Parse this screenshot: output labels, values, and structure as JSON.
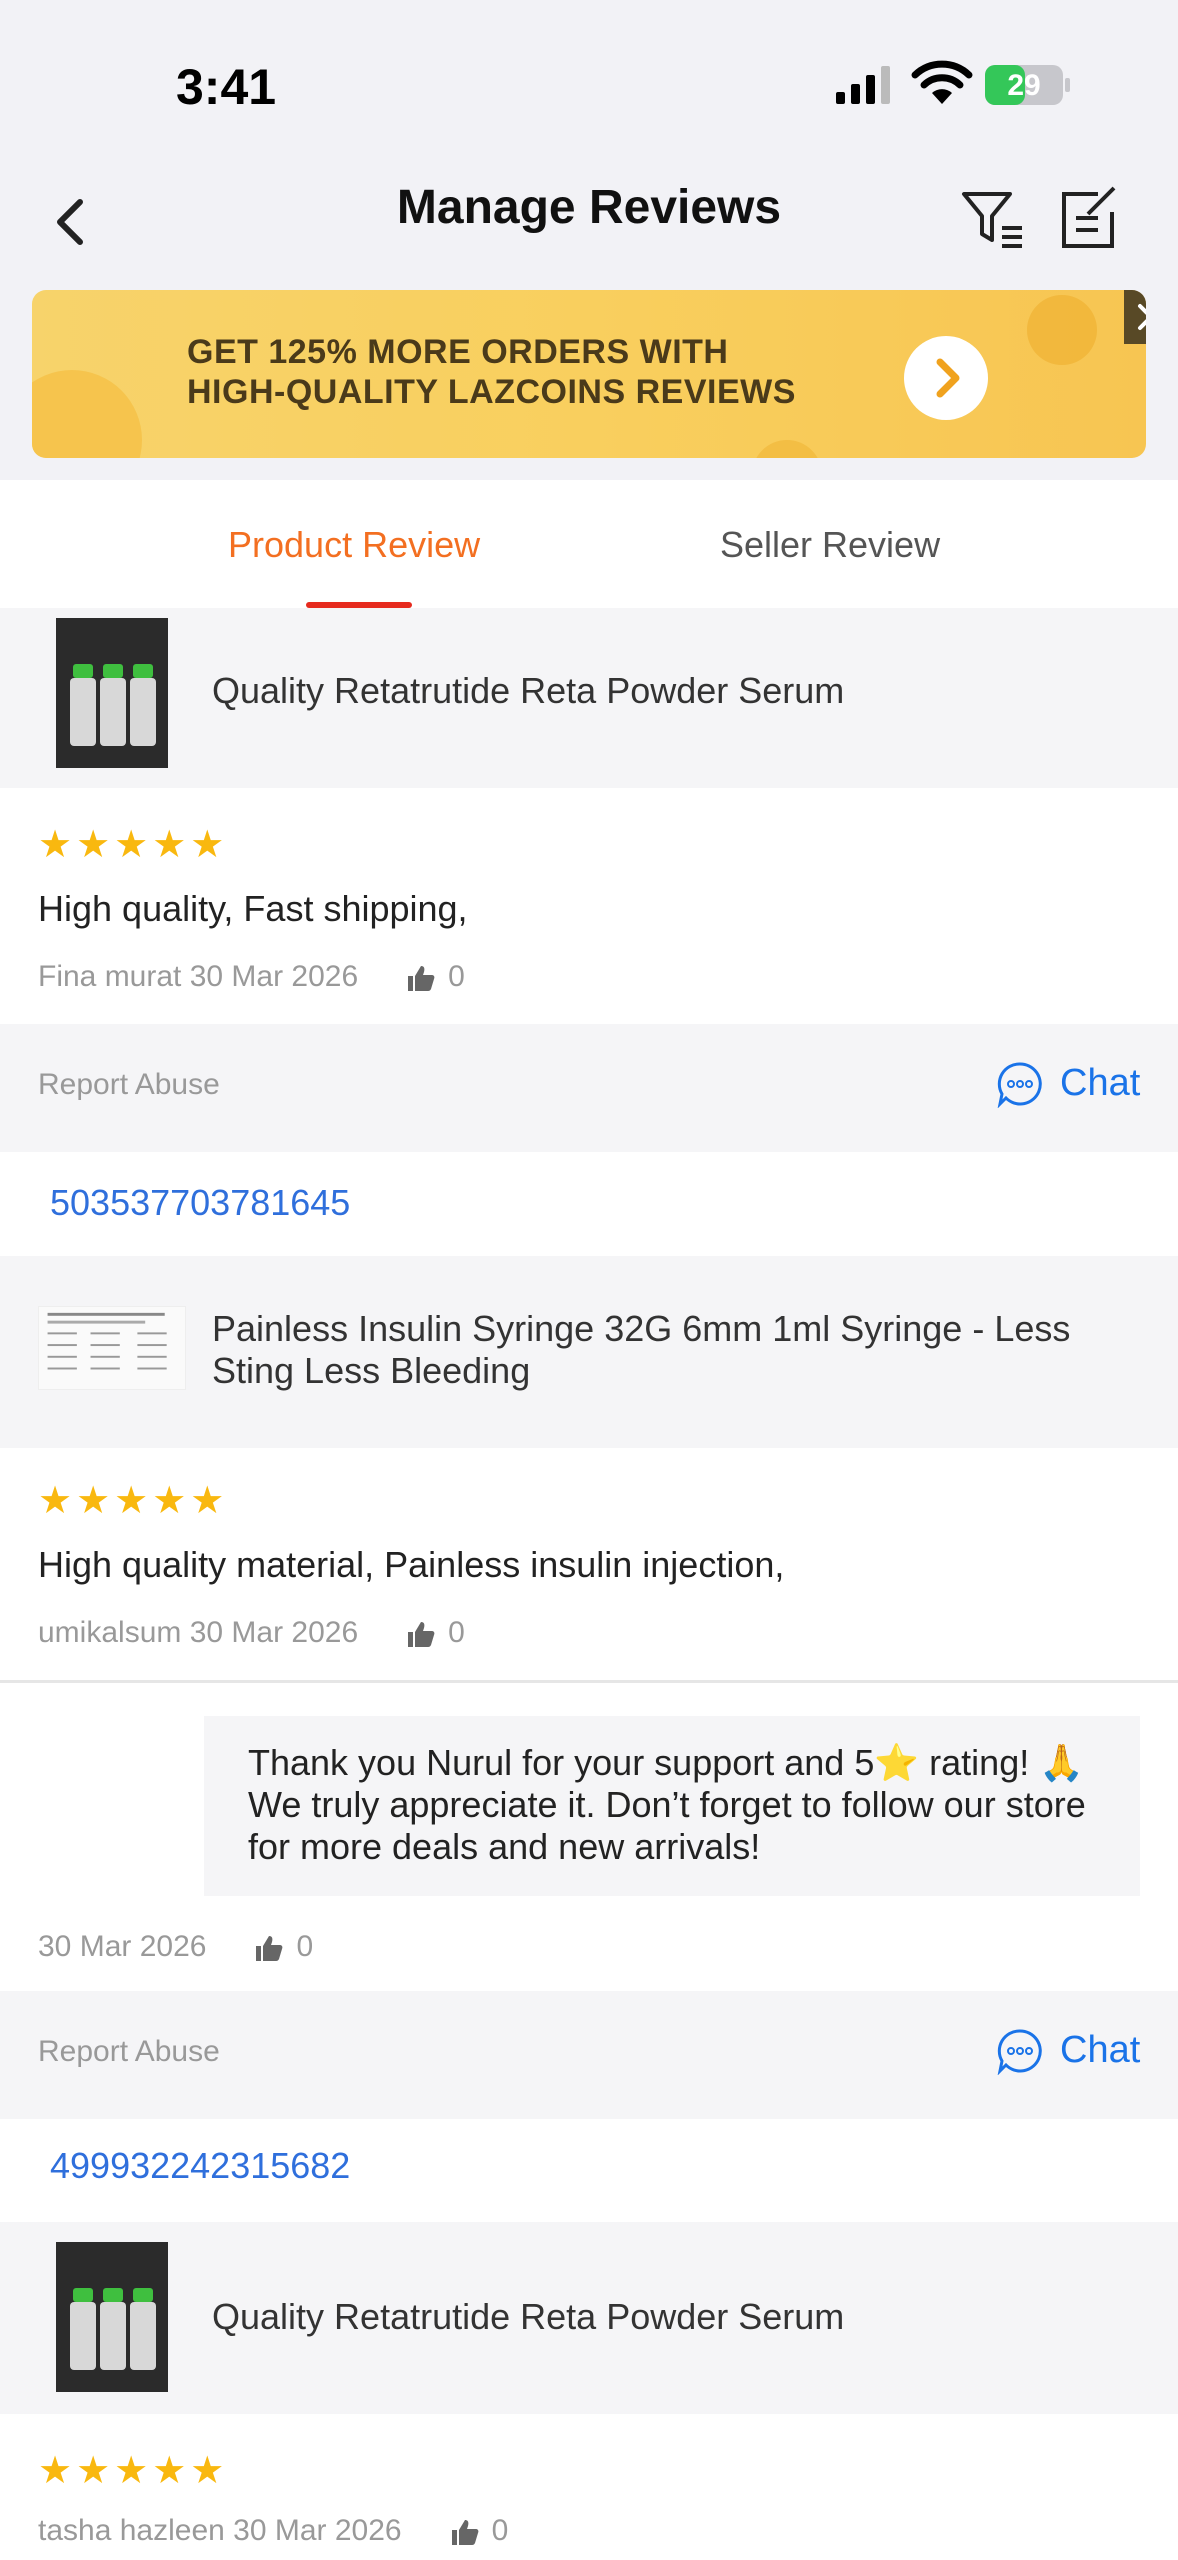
{
  "status_bar": {
    "time": "3:41",
    "battery": "29"
  },
  "header": {
    "title": "Manage Reviews"
  },
  "banner": {
    "line1": "GET 125% MORE ORDERS WITH",
    "line2": "HIGH-QUALITY LAZCOINS REVIEWS"
  },
  "tabs": [
    {
      "label": "Product Review"
    },
    {
      "label": "Seller Review"
    }
  ],
  "reviews": [
    {
      "product_title": "Quality Retatrutide Reta Powder Serum",
      "stars": "★★★★★",
      "text": "High quality, Fast shipping,",
      "meta": "Fina murat 30 Mar 2026",
      "likes": "0",
      "report": "Report Abuse",
      "chat": "Chat"
    },
    {
      "order_number": "503537703781645",
      "product_title": "Painless Insulin Syringe 32G 6mm 1ml Syringe - Less Sting Less Bleeding",
      "stars": "★★★★★",
      "text": "High quality material, Painless insulin injection,",
      "meta": "umikalsum 30 Mar 2026",
      "likes": "0",
      "reply_text": "Thank you Nurul for your support and 5⭐ rating! 🙏 We truly appreciate it. Don’t forget to follow our store for more deals and new arrivals!",
      "reply_date": "30 Mar 2026",
      "reply_likes": "0",
      "report": "Report Abuse",
      "chat": "Chat"
    },
    {
      "order_number": "499932242315682",
      "product_title": "Quality Retatrutide Reta Powder Serum",
      "stars": "★★★★★",
      "meta": "tasha hazleen 30 Mar 2026",
      "likes": "0"
    }
  ],
  "colors": {
    "accent": "#f36f21",
    "link": "#2f6fdc",
    "chat": "#1a73e8",
    "star": "#f9b80f",
    "tab_underline": "#e62a1e"
  }
}
